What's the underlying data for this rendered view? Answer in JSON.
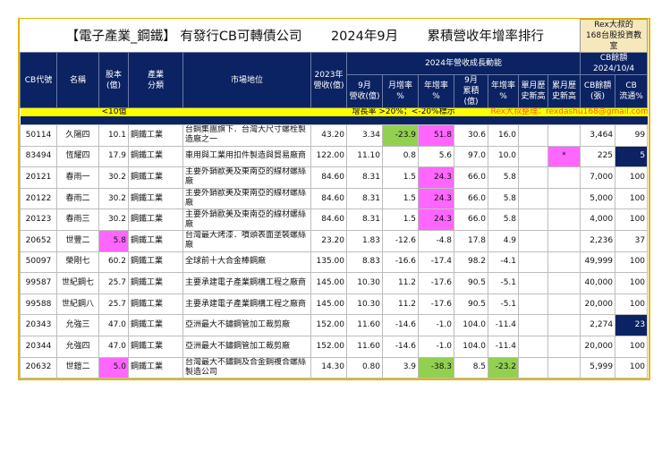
{
  "title": {
    "main": "【電子產業_鋼鐵】 有發行CB可轉債公司",
    "period": "2024年9月",
    "ranking": "累積營收年增率排行",
    "brand_line1": "Rex大叔的",
    "brand_line2": "168台股投資教室"
  },
  "headers": {
    "cb_code": "CB代號",
    "name": "名稱",
    "capital": "股本\n(億)",
    "industry": "產業\n分類",
    "market": "市場地位",
    "rev2023": "2023年\n營收(億)",
    "group_growth": "2024年營收成長動能",
    "group_cb": "CB餘額\n2024/10/4",
    "sep_rev": "9月\n營收(億)",
    "mom": "月增率\n%",
    "yoy": "年增率\n%",
    "sep_cum": "9月\n累積(億)",
    "cum_yoy": "年增率\n%",
    "month_high": "單月歷\n史新高",
    "cum_high": "累月歷\n史新高",
    "cb_balance": "CB餘額\n(張)",
    "cb_float": "CB\n流通%"
  },
  "legend": {
    "capital_note": "<10億",
    "growth_note": "增長率 >20%；<-20%標示",
    "credit": "Rex大叔整理：rexdashu168@gmail.com"
  },
  "colors": {
    "navy": "#0b2362",
    "yellow": "#ffff00",
    "pink": "#ff66ff",
    "green": "#92d050",
    "gold": "#e2b400"
  },
  "rows": [
    {
      "code": "50114",
      "name": "久陽四",
      "capital": "10.1",
      "industry": "鋼鐵工業",
      "market": "台鋼集團旗下．台灣大尺寸螺栓製造廠之一",
      "rev2023": "43.20",
      "sep_rev": "3.34",
      "mom": "-23.9",
      "yoy": "51.8",
      "sep_cum": "30.6",
      "cum_yoy": "16.0",
      "month_high": "",
      "cum_high": "",
      "cb_balance": "3,464",
      "cb_float": "99",
      "hl": {
        "mom": "green",
        "yoy": "pink"
      }
    },
    {
      "code": "83494",
      "name": "恆耀四",
      "capital": "17.9",
      "industry": "鋼鐵工業",
      "market": "車用與工業用扣件製造與貿易廠商",
      "rev2023": "122.00",
      "sep_rev": "11.10",
      "mom": "0.8",
      "yoy": "5.6",
      "sep_cum": "97.0",
      "cum_yoy": "10.0",
      "month_high": "",
      "cum_high": "*",
      "cb_balance": "225",
      "cb_float": "5",
      "hl": {
        "cum_high": "pink",
        "cb_float": "navyc"
      }
    },
    {
      "code": "20121",
      "name": "春雨一",
      "capital": "30.2",
      "industry": "鋼鐵工業",
      "market": "主要外銷歐美及東南亞的線材螺絲廠",
      "rev2023": "84.60",
      "sep_rev": "8.31",
      "mom": "1.5",
      "yoy": "24.3",
      "sep_cum": "66.0",
      "cum_yoy": "5.8",
      "month_high": "",
      "cum_high": "",
      "cb_balance": "7,000",
      "cb_float": "100",
      "hl": {
        "yoy": "pink"
      }
    },
    {
      "code": "20122",
      "name": "春雨二",
      "capital": "30.2",
      "industry": "鋼鐵工業",
      "market": "主要外銷歐美及東南亞的線材螺絲廠",
      "rev2023": "84.60",
      "sep_rev": "8.31",
      "mom": "1.5",
      "yoy": "24.3",
      "sep_cum": "66.0",
      "cum_yoy": "5.8",
      "month_high": "",
      "cum_high": "",
      "cb_balance": "5,000",
      "cb_float": "100",
      "hl": {
        "yoy": "pink"
      }
    },
    {
      "code": "20123",
      "name": "春雨三",
      "capital": "30.2",
      "industry": "鋼鐵工業",
      "market": "主要外銷歐美及東南亞的線材螺絲廠",
      "rev2023": "84.60",
      "sep_rev": "8.31",
      "mom": "1.5",
      "yoy": "24.3",
      "sep_cum": "66.0",
      "cum_yoy": "5.8",
      "month_high": "",
      "cum_high": "",
      "cb_balance": "4,000",
      "cb_float": "100",
      "hl": {
        "yoy": "pink"
      }
    },
    {
      "code": "20652",
      "name": "世豐二",
      "capital": "5.8",
      "industry": "鋼鐵工業",
      "market": "台灣最大烤漆．噴頭表面塗裝螺絲廠",
      "rev2023": "23.20",
      "sep_rev": "1.83",
      "mom": "-12.6",
      "yoy": "-4.8",
      "sep_cum": "17.8",
      "cum_yoy": "4.9",
      "month_high": "",
      "cum_high": "",
      "cb_balance": "2,236",
      "cb_float": "37",
      "hl": {
        "capital": "pink"
      }
    },
    {
      "code": "50097",
      "name": "榮剛七",
      "capital": "60.2",
      "industry": "鋼鐵工業",
      "market": "全球前十大合金棒鋼廠",
      "rev2023": "135.00",
      "sep_rev": "8.83",
      "mom": "-16.6",
      "yoy": "-17.4",
      "sep_cum": "98.2",
      "cum_yoy": "-4.1",
      "month_high": "",
      "cum_high": "",
      "cb_balance": "49,999",
      "cb_float": "100",
      "hl": {}
    },
    {
      "code": "99587",
      "name": "世紀鋼七",
      "capital": "25.7",
      "industry": "鋼鐵工業",
      "market": "主要承建電子產業鋼構工程之廠商",
      "rev2023": "145.00",
      "sep_rev": "10.30",
      "mom": "11.2",
      "yoy": "-17.6",
      "sep_cum": "90.5",
      "cum_yoy": "-5.1",
      "month_high": "",
      "cum_high": "",
      "cb_balance": "40,000",
      "cb_float": "100",
      "hl": {}
    },
    {
      "code": "99588",
      "name": "世紀鋼八",
      "capital": "25.7",
      "industry": "鋼鐵工業",
      "market": "主要承建電子產業鋼構工程之廠商",
      "rev2023": "145.00",
      "sep_rev": "10.30",
      "mom": "11.2",
      "yoy": "-17.6",
      "sep_cum": "90.5",
      "cum_yoy": "-5.1",
      "month_high": "",
      "cum_high": "",
      "cb_balance": "20,000",
      "cb_float": "100",
      "hl": {}
    },
    {
      "code": "20343",
      "name": "允強三",
      "capital": "47.0",
      "industry": "鋼鐵工業",
      "market": "亞洲最大不鏽鋼管加工裁剪廠",
      "rev2023": "152.00",
      "sep_rev": "11.60",
      "mom": "-14.6",
      "yoy": "-1.0",
      "sep_cum": "104.0",
      "cum_yoy": "-11.4",
      "month_high": "",
      "cum_high": "",
      "cb_balance": "2,274",
      "cb_float": "23",
      "hl": {
        "cb_float": "navyc"
      }
    },
    {
      "code": "20344",
      "name": "允強四",
      "capital": "47.0",
      "industry": "鋼鐵工業",
      "market": "亞洲最大不鏽鋼管加工裁剪廠",
      "rev2023": "152.00",
      "sep_rev": "11.60",
      "mom": "-14.6",
      "yoy": "-1.0",
      "sep_cum": "104.0",
      "cum_yoy": "-11.4",
      "month_high": "",
      "cum_high": "",
      "cb_balance": "20,000",
      "cb_float": "100",
      "hl": {}
    },
    {
      "code": "20632",
      "name": "世鎧二",
      "capital": "5.0",
      "industry": "鋼鐵工業",
      "market": "台灣最大不鏽鋼及合金鋼複合螺絲製造公司",
      "rev2023": "14.30",
      "sep_rev": "0.80",
      "mom": "3.9",
      "yoy": "-38.3",
      "sep_cum": "8.5",
      "cum_yoy": "-23.2",
      "month_high": "",
      "cum_high": "",
      "cb_balance": "5,999",
      "cb_float": "100",
      "hl": {
        "capital": "pink",
        "yoy": "green",
        "cum_yoy": "green"
      }
    }
  ]
}
